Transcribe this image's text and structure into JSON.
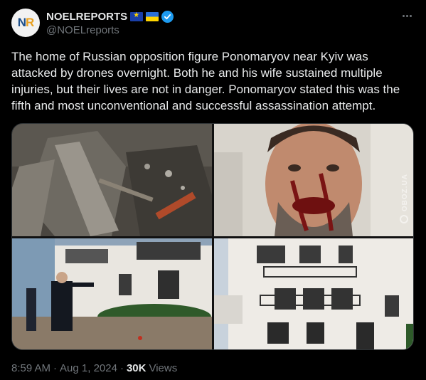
{
  "author": {
    "display_name": "NOELREPORTS",
    "handle": "@NOELreports",
    "avatar_text": "NR",
    "verified": true,
    "badges": [
      "eu-flag-icon",
      "ukraine-flag-icon",
      "verified-badge-icon"
    ]
  },
  "tweet": {
    "text": "The home of Russian opposition figure Ponomaryov near Kyiv was attacked by drones overnight. Both he and his wife sustained multiple injuries, but their lives are not in danger. Ponomaryov stated this was the fifth and most unconventional and successful assassination attempt."
  },
  "media": {
    "count": 4,
    "items": [
      {
        "icon": "rubble-photo",
        "description_name": "debris-photo"
      },
      {
        "icon": "injured-man-photo",
        "description_name": "selfie-photo",
        "watermark": "OBOZ.UA"
      },
      {
        "icon": "house-exterior-photo",
        "description_name": "investigators-photo"
      },
      {
        "icon": "damaged-house-photo",
        "description_name": "house-facade-photo"
      }
    ]
  },
  "footer": {
    "time": "8:59 AM",
    "separator": "·",
    "date": "Aug 1, 2024",
    "views_count": "30K",
    "views_label": "Views"
  },
  "colors": {
    "background": "#000000",
    "text": "#e7e9ea",
    "secondary": "#71767b",
    "verified": "#1d9bf0"
  }
}
